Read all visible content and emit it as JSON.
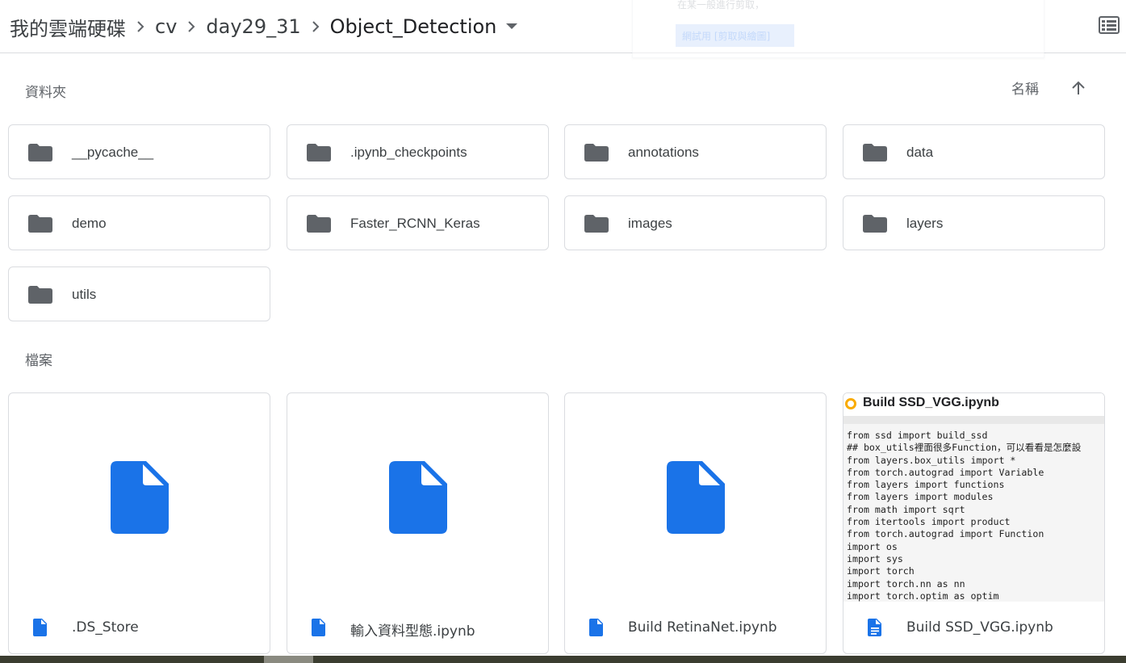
{
  "breadcrumb": {
    "items": [
      "我的雲端硬碟",
      "cv",
      "day29_31",
      "Object_Detection"
    ]
  },
  "popup": {
    "text": "在某一般進行剪取，",
    "button_label": "網試用 [剪取與繪圖]"
  },
  "sections": {
    "folders_label": "資料夾",
    "files_label": "檔案"
  },
  "sort": {
    "label": "名稱",
    "direction": "ascending"
  },
  "folders": [
    {
      "name": "__pycache__"
    },
    {
      "name": ".ipynb_checkpoints"
    },
    {
      "name": "annotations"
    },
    {
      "name": "data"
    },
    {
      "name": "demo"
    },
    {
      "name": "Faster_RCNN_Keras"
    },
    {
      "name": "images"
    },
    {
      "name": "layers"
    },
    {
      "name": "utils"
    }
  ],
  "files": [
    {
      "name": ".DS_Store",
      "icon": "file-icon"
    },
    {
      "name": "輸入資料型態.ipynb",
      "icon": "file-icon"
    },
    {
      "name": "Build RetinaNet.ipynb",
      "icon": "file-icon"
    },
    {
      "name": "Build SSD_VGG.ipynb",
      "icon": "doc-icon"
    }
  ],
  "notebook_preview": {
    "title": "Build SSD_VGG.ipynb",
    "lines": [
      "from ssd import build_ssd",
      "## box_utils裡面很多Function，可以看看是怎麼設",
      "from layers.box_utils import *",
      "from torch.autograd import Variable",
      "from layers import functions",
      "from layers import modules",
      "from math import sqrt",
      "from itertools import product",
      "from torch.autograd import Function",
      "import os",
      "import sys",
      "import torch",
      "import torch.nn as nn",
      "import torch.optim as optim"
    ]
  },
  "colors": {
    "folder_icon": "#5f6368",
    "file_icon": "#1a73e8",
    "border": "#dadce0",
    "text": "#3c4043"
  }
}
